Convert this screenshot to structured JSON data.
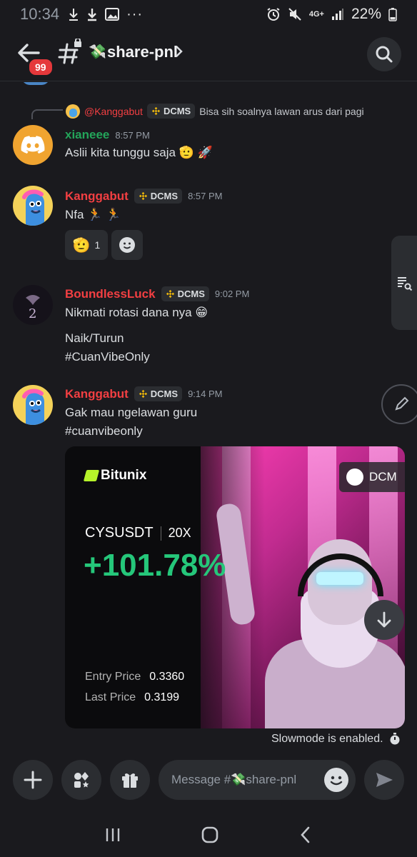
{
  "status_bar": {
    "time": "10:34",
    "dots": "···",
    "network": "4G+",
    "battery": "22%"
  },
  "header": {
    "unread_badge": "99",
    "channel_emoji": "💸",
    "channel_name": "share-pnl"
  },
  "reply": {
    "name": "@Kanggabut",
    "tag": "DCMS",
    "text": "Bisa sih soalnya lawan arus dari pagi"
  },
  "messages": [
    {
      "user": "xianeee",
      "user_color": "#23a55a",
      "time": "8:57 PM",
      "lines": [
        "Aslii kita tunggu saja 🫡 🚀"
      ]
    },
    {
      "user": "Kanggabut",
      "user_color": "#f23f42",
      "tag": "DCMS",
      "time": "8:57 PM",
      "lines": [
        "Nfa 🏃 🏃"
      ],
      "reactions": [
        {
          "emoji": "🫡",
          "count": "1"
        }
      ]
    },
    {
      "user": "BoundlessLuck",
      "user_color": "#f23f42",
      "tag": "DCMS",
      "time": "9:02 PM",
      "lines": [
        "Nikmati rotasi dana nya 😁",
        "Naik/Turun",
        "#CuanVibeOnly"
      ]
    },
    {
      "user": "Kanggabut",
      "user_color": "#f23f42",
      "tag": "DCMS",
      "time": "9:14 PM",
      "lines": [
        "Gak mau ngelawan guru",
        "#cuanvibeonly"
      ]
    }
  ],
  "card": {
    "brand": "Bitunix",
    "dcm_label": "DCM",
    "pair": "CYSUSDT",
    "leverage": "20X",
    "pnl": "+101.78%",
    "entry_label": "Entry Price",
    "entry_value": "0.3360",
    "last_label": "Last Price",
    "last_value": "0.3199"
  },
  "slowmode_text": "Slowmode is enabled.",
  "composer": {
    "placeholder": "Message #💸share-pnl"
  }
}
